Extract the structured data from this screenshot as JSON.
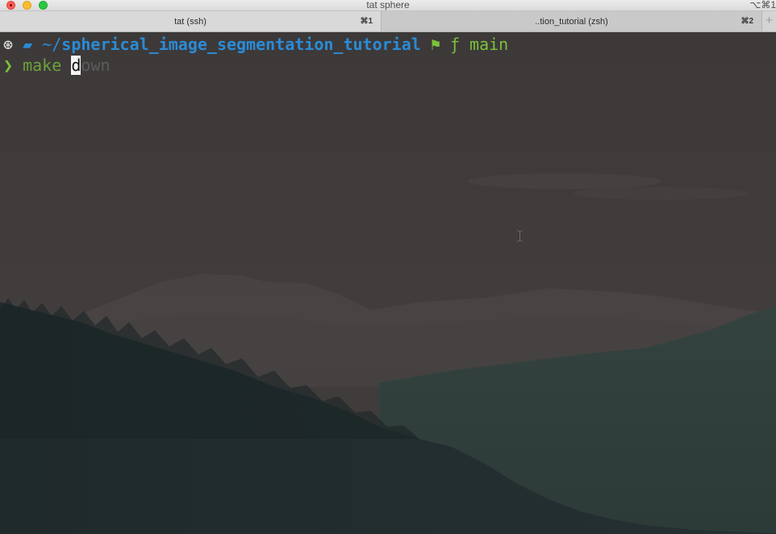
{
  "window": {
    "title": "tat sphere",
    "title_shortcut": "⌥⌘1"
  },
  "tabs": [
    {
      "label": "tat (ssh)",
      "shortcut": "⌘1",
      "active": true
    },
    {
      "label": "..tion_tutorial (zsh)",
      "shortcut": "⌘2",
      "active": false
    }
  ],
  "new_tab_label": "+",
  "terminal": {
    "prompt": {
      "os_icon": "ubuntu-icon",
      "os_glyph": "⊛",
      "folder_icon": "folder-icon",
      "folder_glyph": "▰",
      "path_prefix": "~/",
      "path": "spherical_image_segmentation_tutorial",
      "git_icon": "github-icon",
      "git_glyph": "⚑",
      "branch_icon": "git-branch-icon",
      "branch_glyph": "ƒ",
      "branch": "main"
    },
    "command": {
      "chevron": "❯",
      "typed": "make ",
      "cursor_char": "d",
      "suggestion": "own"
    }
  },
  "colors": {
    "path": "#2a8bd6",
    "branch": "#7cc23a",
    "command": "#6aa33a",
    "suggestion": "#5c5c5c",
    "background": "#3c3939"
  }
}
